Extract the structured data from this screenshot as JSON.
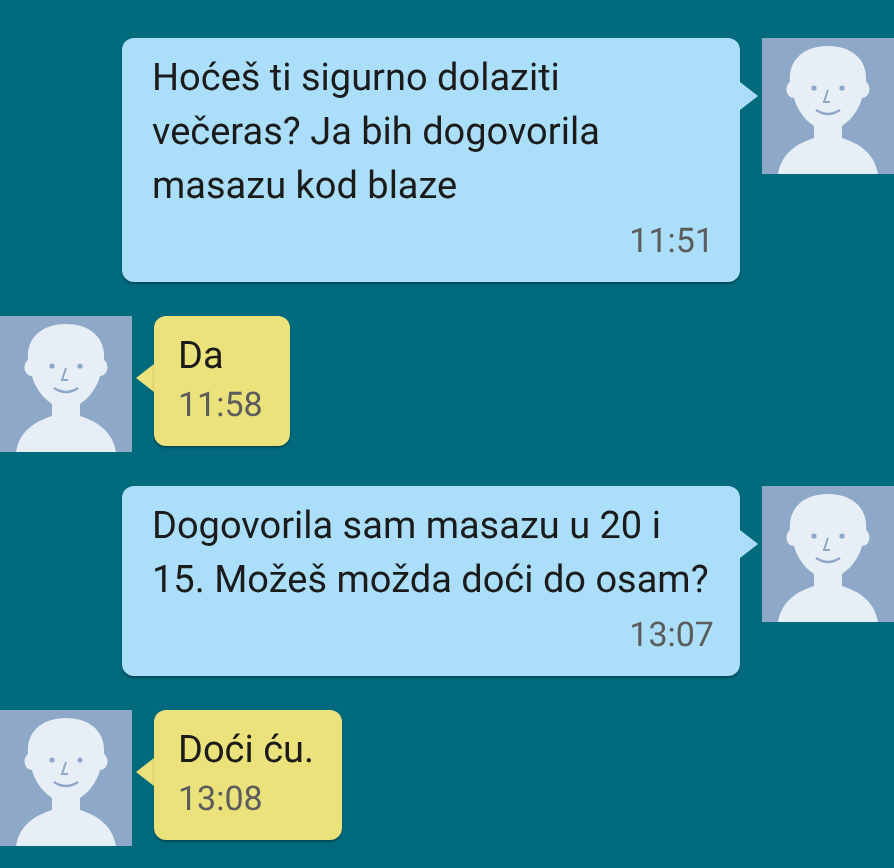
{
  "messages": [
    {
      "kind": "sent",
      "text": "Hoćeš ti sigurno dolaziti večeras?  Ja bih dogovorila masazu kod blaze",
      "time": "11:51"
    },
    {
      "kind": "received",
      "text": "Da",
      "time": "11:58"
    },
    {
      "kind": "sent",
      "text": "Dogovorila sam masazu u 20 i 15. Možeš možda doći do osam?",
      "time": "13:07"
    },
    {
      "kind": "received",
      "text": "Doći ću.",
      "time": "13:08"
    }
  ]
}
